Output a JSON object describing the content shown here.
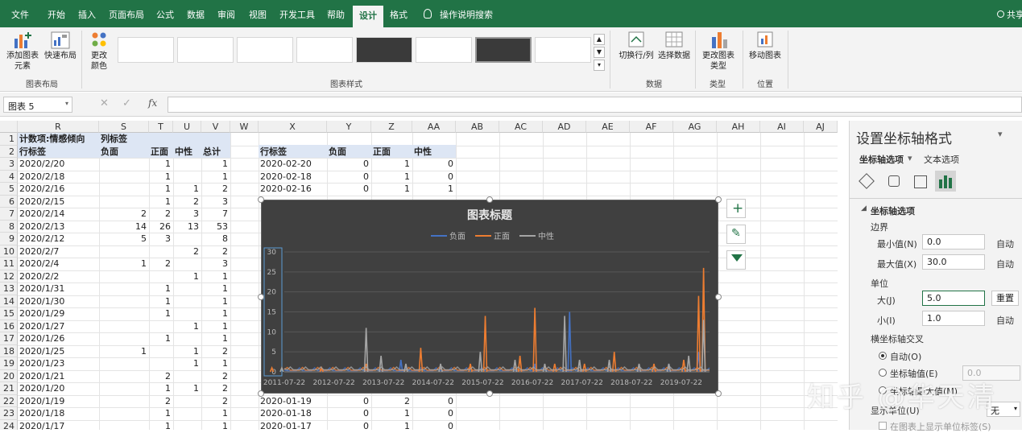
{
  "tabs": [
    "文件",
    "开始",
    "插入",
    "页面布局",
    "公式",
    "数据",
    "审阅",
    "视图",
    "开发工具",
    "帮助",
    "设计",
    "格式"
  ],
  "search_label": "操作说明搜索",
  "share_label": "共享",
  "ribbon": {
    "add_element": "添加图表元素",
    "quick_layout": "快速布局",
    "group_layout": "图表布局",
    "change_colors": "更改颜色",
    "group_styles": "图表样式",
    "switch_row_col": "切换行/列",
    "select_data": "选择数据",
    "group_data": "数据",
    "change_type": "更改图表类型",
    "group_type": "类型",
    "move_chart": "移动图表",
    "group_location": "位置"
  },
  "name_box": "图表 5",
  "columns": [
    "R",
    "S",
    "T",
    "U",
    "V",
    "W",
    "X",
    "Y",
    "Z",
    "AA",
    "AB",
    "AC",
    "AD",
    "AE",
    "AF",
    "AG",
    "AH",
    "AI",
    "AJ"
  ],
  "pivot": {
    "title": "计数项:情感倾向",
    "col_label": "列标签",
    "row_label": "行标签",
    "headers": [
      "负面",
      "正面",
      "中性",
      "总计"
    ],
    "rows": [
      [
        "2020/2/20",
        "",
        "1",
        "",
        "1"
      ],
      [
        "2020/2/18",
        "",
        "1",
        "",
        "1"
      ],
      [
        "2020/2/16",
        "",
        "1",
        "1",
        "2"
      ],
      [
        "2020/2/15",
        "",
        "1",
        "2",
        "3"
      ],
      [
        "2020/2/14",
        "2",
        "2",
        "3",
        "7"
      ],
      [
        "2020/2/13",
        "14",
        "26",
        "13",
        "53"
      ],
      [
        "2020/2/12",
        "5",
        "3",
        "",
        "8"
      ],
      [
        "2020/2/7",
        "",
        "",
        "2",
        "2"
      ],
      [
        "2020/2/4",
        "1",
        "2",
        "",
        "3"
      ],
      [
        "2020/2/2",
        "",
        "",
        "1",
        "1"
      ],
      [
        "2020/1/31",
        "",
        "1",
        "",
        "1"
      ],
      [
        "2020/1/30",
        "",
        "1",
        "",
        "1"
      ],
      [
        "2020/1/29",
        "",
        "1",
        "",
        "1"
      ],
      [
        "2020/1/27",
        "",
        "",
        "1",
        "1"
      ],
      [
        "2020/1/26",
        "",
        "1",
        "",
        "1"
      ],
      [
        "2020/1/25",
        "1",
        "",
        "1",
        "2"
      ],
      [
        "2020/1/23",
        "",
        "",
        "1",
        "1"
      ],
      [
        "2020/1/21",
        "",
        "2",
        "",
        "2"
      ],
      [
        "2020/1/20",
        "",
        "1",
        "1",
        "2"
      ],
      [
        "2020/1/19",
        "",
        "2",
        "",
        "2"
      ],
      [
        "2020/1/18",
        "",
        "1",
        "",
        "1"
      ],
      [
        "2020/1/17",
        "",
        "1",
        "",
        "1"
      ]
    ]
  },
  "table2": {
    "headers": [
      "行标签",
      "负面",
      "正面",
      "中性"
    ],
    "rows_top": [
      [
        "2020-02-20",
        "0",
        "1",
        "0"
      ],
      [
        "2020-02-18",
        "0",
        "1",
        "0"
      ],
      [
        "2020-02-16",
        "0",
        "1",
        "1"
      ]
    ],
    "rows_bottom": [
      [
        "2020-01-19",
        "0",
        "2",
        "0"
      ],
      [
        "2020-01-18",
        "0",
        "1",
        "0"
      ],
      [
        "2020-01-17",
        "0",
        "1",
        "0"
      ]
    ]
  },
  "chart_data": {
    "type": "line",
    "title": "图表标题",
    "series": [
      {
        "name": "负面",
        "color": "#4472c4",
        "spikes": [
          [
            2013.9,
            3
          ],
          [
            2016.6,
            2
          ],
          [
            2017.3,
            15
          ],
          [
            2019.3,
            2
          ],
          [
            2019.9,
            5
          ]
        ]
      },
      {
        "name": "正面",
        "color": "#ed7d31",
        "spikes": [
          [
            2011.3,
            1
          ],
          [
            2012.3,
            1
          ],
          [
            2013.2,
            2
          ],
          [
            2014.3,
            6
          ],
          [
            2015.3,
            2
          ],
          [
            2015.6,
            14
          ],
          [
            2016.3,
            4
          ],
          [
            2016.6,
            16
          ],
          [
            2017.0,
            2
          ],
          [
            2017.6,
            2
          ],
          [
            2018.2,
            5
          ],
          [
            2019.0,
            2
          ],
          [
            2019.6,
            3
          ],
          [
            2019.9,
            19
          ],
          [
            2020.0,
            26
          ]
        ]
      },
      {
        "name": "中性",
        "color": "#a5a5a5",
        "spikes": [
          [
            2011.5,
            1
          ],
          [
            2013.2,
            11
          ],
          [
            2013.5,
            4
          ],
          [
            2014.0,
            2
          ],
          [
            2014.7,
            2
          ],
          [
            2015.5,
            5
          ],
          [
            2016.2,
            3
          ],
          [
            2016.8,
            2
          ],
          [
            2017.2,
            14
          ],
          [
            2017.5,
            3
          ],
          [
            2018.1,
            3
          ],
          [
            2018.7,
            2
          ],
          [
            2019.3,
            2
          ],
          [
            2019.7,
            4
          ],
          [
            2020.0,
            13
          ]
        ]
      }
    ],
    "x_ticks": [
      "2011-07-22",
      "2012-07-22",
      "2013-07-22",
      "2014-07-22",
      "2015-07-22",
      "2016-07-22",
      "2017-07-22",
      "2018-07-22",
      "2019-07-22"
    ],
    "x_range": [
      2011.55,
      2020.12
    ],
    "y_ticks": [
      "0",
      "5",
      "10",
      "15",
      "20",
      "25",
      "30"
    ],
    "ylim": [
      0,
      30
    ],
    "grid": true,
    "legend": "top"
  },
  "pane": {
    "title": "设置坐标轴格式",
    "tab_axis": "坐标轴选项",
    "tab_text": "文本选项",
    "section": "坐标轴选项",
    "bounds": "边界",
    "min_label": "最小值(N)",
    "min_value": "0.0",
    "min_mode": "自动",
    "max_label": "最大值(X)",
    "max_value": "30.0",
    "max_mode": "自动",
    "units": "单位",
    "major_label": "大(J)",
    "major_value": "5.0",
    "major_btn": "重置",
    "minor_label": "小(I)",
    "minor_value": "1.0",
    "minor_mode": "自动",
    "cross": "横坐标轴交叉",
    "cross_auto": "自动(O)",
    "cross_value_label": "坐标轴值(E)",
    "cross_value": "0.0",
    "cross_max": "坐标轴最大值(M)",
    "display_units": "显示单位(U)",
    "display_units_value": "无",
    "show_units": "在图表上显示单位标签(S)"
  },
  "watermark": "知乎 @华天清"
}
